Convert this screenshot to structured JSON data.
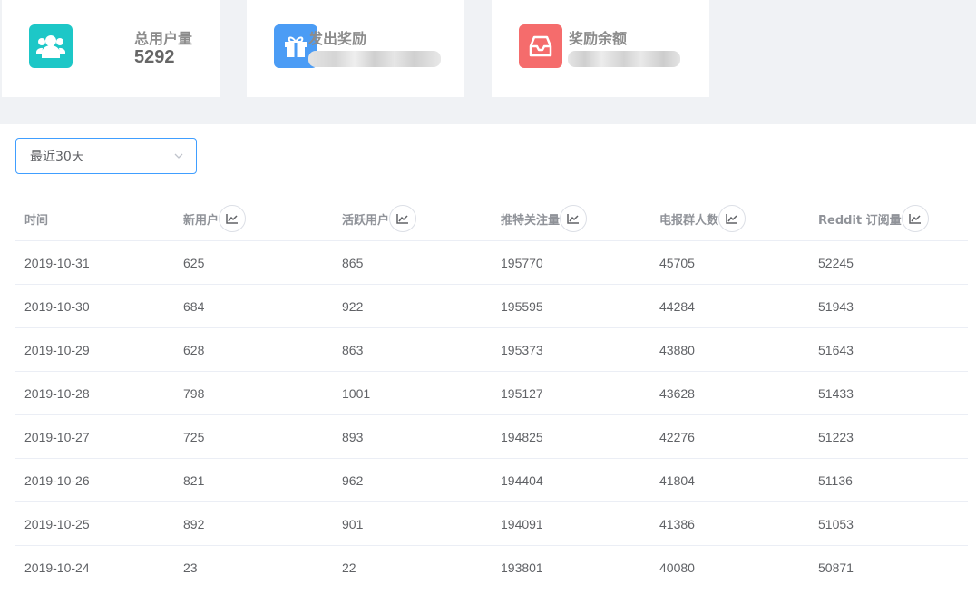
{
  "stats": [
    {
      "label": "总用户量",
      "value": "5292",
      "icon": "users-icon",
      "color": "#1dc7c7"
    },
    {
      "label": "发出奖励",
      "value": "",
      "icon": "gift-icon",
      "color": "#4b9cf5"
    },
    {
      "label": "奖励余额",
      "value": "",
      "icon": "inbox-icon",
      "color": "#f56c6c"
    }
  ],
  "filter": {
    "selected": "最近30天"
  },
  "table": {
    "headers": [
      "时间",
      "新用户",
      "活跃用户",
      "推特关注量",
      "电报群人数",
      "Reddit 订阅量"
    ],
    "rows": [
      [
        "2019-10-31",
        "625",
        "865",
        "195770",
        "45705",
        "52245"
      ],
      [
        "2019-10-30",
        "684",
        "922",
        "195595",
        "44284",
        "51943"
      ],
      [
        "2019-10-29",
        "628",
        "863",
        "195373",
        "43880",
        "51643"
      ],
      [
        "2019-10-28",
        "798",
        "1001",
        "195127",
        "43628",
        "51433"
      ],
      [
        "2019-10-27",
        "725",
        "893",
        "194825",
        "42276",
        "51223"
      ],
      [
        "2019-10-26",
        "821",
        "962",
        "194404",
        "41804",
        "51136"
      ],
      [
        "2019-10-25",
        "892",
        "901",
        "194091",
        "41386",
        "51053"
      ],
      [
        "2019-10-24",
        "23",
        "22",
        "193801",
        "40080",
        "50871"
      ]
    ]
  }
}
